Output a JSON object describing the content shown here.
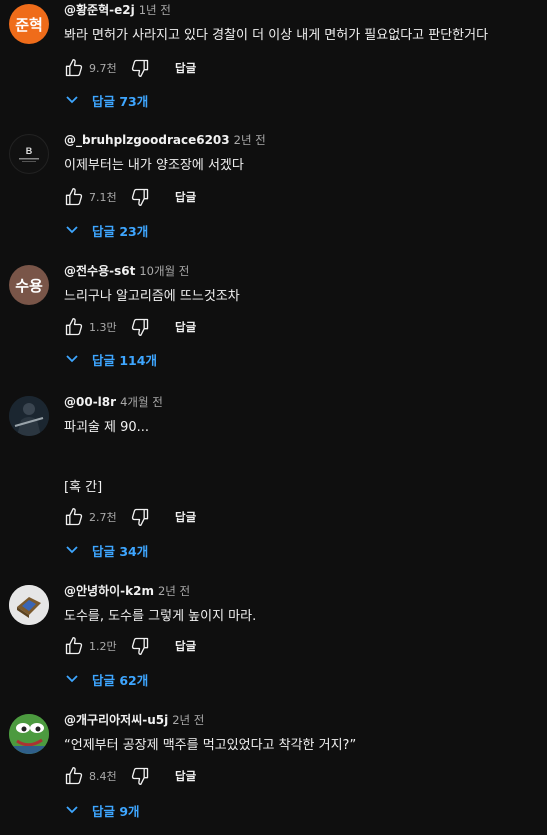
{
  "colors": {
    "background": "#0f0f0f",
    "text": "#f1f1f1",
    "meta": "#aaaaaa",
    "link": "#3ea6ff"
  },
  "comments": [
    {
      "author": "@황준혁-e2j",
      "time": "1년 전",
      "avatar_text": "준혁",
      "avatar_color": "#ef6c1a",
      "text": [
        "봐라 면허가 사라지고 있다 경찰이 더 이상 내게 면허가 필요없다고 판단한거다"
      ],
      "likes": "9.7천",
      "reply_label": "답글",
      "replies_label": "답글 73개"
    },
    {
      "author": "@_bruhplzgoodrace6203",
      "time": "2년 전",
      "avatar_text": "B",
      "text": [
        "이제부터는 내가 양조장에 서겠다"
      ],
      "likes": "7.1천",
      "reply_label": "답글",
      "replies_label": "답글 23개"
    },
    {
      "author": "@전수용-s6t",
      "time": "10개월 전",
      "avatar_text": "수용",
      "avatar_color": "#795548",
      "text": [
        "느리구나 알고리즘에 뜨느것조차"
      ],
      "likes": "1.3만",
      "reply_label": "답글",
      "replies_label": "답글 114개"
    },
    {
      "author": "@00-l8r",
      "time": "4개월 전",
      "avatar_text": "",
      "text": [
        "파괴술 제 90...",
        "",
        "[혹 간]"
      ],
      "likes": "2.7천",
      "reply_label": "답글",
      "replies_label": "답글 34개"
    },
    {
      "author": "@안녕하이-k2m",
      "time": "2년 전",
      "avatar_text": "",
      "text": [
        "도수를, 도수를 그렇게 높이지 마라."
      ],
      "likes": "1.2만",
      "reply_label": "답글",
      "replies_label": "답글 62개"
    },
    {
      "author": "@개구리아저씨-u5j",
      "time": "2년 전",
      "avatar_text": "",
      "text": [
        "“언제부터 공장제 맥주를 먹고있었다고 착각한 거지?”"
      ],
      "likes": "8.4천",
      "reply_label": "답글",
      "replies_label": "답글 9개"
    }
  ],
  "icons": {
    "like": "thumbs-up-icon",
    "dislike": "thumbs-down-icon",
    "expand": "chevron-down-icon"
  }
}
